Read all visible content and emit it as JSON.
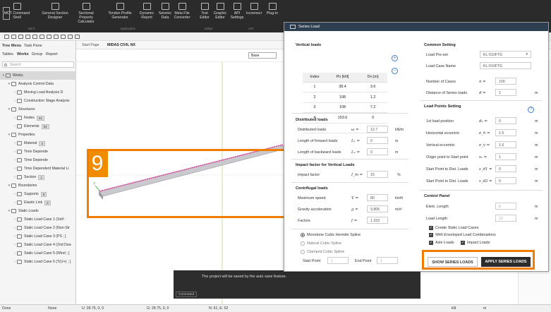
{
  "ribbon": {
    "buttons": [
      {
        "label": "MCT Command",
        "label2": "Shell"
      },
      {
        "label": "General Section",
        "label2": "Designer"
      },
      {
        "label": "Sectional Property",
        "label2": "Calculator"
      },
      {
        "label": "Tendon Profile",
        "label2": "Generator"
      },
      {
        "label": "Dynamic",
        "label2": "Report"
      },
      {
        "label": "Seismic",
        "label2": "Data"
      },
      {
        "label": "Meta File",
        "label2": "Converter"
      },
      {
        "label": "Text",
        "label2": "Editor"
      },
      {
        "label": "Graphic",
        "label2": "Editor"
      },
      {
        "label": "API",
        "label2": "Settings"
      },
      {
        "label": "Icconnect",
        "label2": ""
      },
      {
        "label": "Plug-in",
        "label2": ""
      }
    ],
    "groups": [
      "MCT",
      "Application",
      "Editor",
      "API"
    ]
  },
  "leftpanel": {
    "tabs_top": [
      "Tree Menu",
      "Task Pane"
    ],
    "tabs": [
      "Tables",
      "Works",
      "Group",
      "Report"
    ],
    "search_placeholder": "Search",
    "tree": [
      {
        "label": "Works",
        "level": 0,
        "sel": true,
        "count": ""
      },
      {
        "label": "Analysis Control Data",
        "level": 1,
        "count": ""
      },
      {
        "label": "Moving Load Analysis D",
        "level": 2,
        "count": ""
      },
      {
        "label": "Construction Stage Analysis",
        "level": 2,
        "count": ""
      },
      {
        "label": "Structures",
        "level": 1,
        "count": ""
      },
      {
        "label": "Nodes",
        "level": 2,
        "count": "61"
      },
      {
        "label": "Elements",
        "level": 2,
        "count": "52"
      },
      {
        "label": "Properties",
        "level": 1,
        "count": ""
      },
      {
        "label": "Material",
        "level": 2,
        "count": "2"
      },
      {
        "label": "Time Depende",
        "level": 2,
        "count": ""
      },
      {
        "label": "Time Depende",
        "level": 2,
        "count": ""
      },
      {
        "label": "Time Dependent Material Li",
        "level": 2,
        "count": ""
      },
      {
        "label": "Section",
        "level": 2,
        "count": "1"
      },
      {
        "label": "Boundaries",
        "level": 1,
        "count": ""
      },
      {
        "label": "Supports",
        "level": 2,
        "count": "8"
      },
      {
        "label": "Elastic Link",
        "level": 2,
        "count": "8"
      },
      {
        "label": "Static Loads",
        "level": 1,
        "count": ""
      },
      {
        "label": "Static Load Case 1 (Self :",
        "level": 2,
        "count": ""
      },
      {
        "label": "Static Load Case 2 (Non-Str",
        "level": 2,
        "count": ""
      },
      {
        "label": "Static Load Case 3 (PS ; [",
        "level": 2,
        "count": ""
      },
      {
        "label": "Static Load Case 4 (2nd Dea",
        "level": 2,
        "count": ""
      },
      {
        "label": "Static Load Case 5 (Wind ; [",
        "level": 2,
        "count": ""
      },
      {
        "label": "Static Load Case 6 (T(U+) ; [",
        "level": 2,
        "count": ""
      }
    ]
  },
  "docbar": {
    "start": "Start Page",
    "current": "MIDAS CIVIL NX",
    "view": "Base"
  },
  "badge": "9",
  "message": "The project will be saved by the auto save feature.",
  "command_label": "Command",
  "status": {
    "left": "Done",
    "mode": "None",
    "u": "U: 28.75, 0, 0",
    "g": "G: 28.75, 0, 0",
    "n": "N: 61, E: 52",
    "unit1": "kN",
    "unit2": "m"
  },
  "dialog": {
    "title": "Series Load",
    "vertical": {
      "title": "Vertical loads",
      "headers": [
        "Index",
        "Pn [kN]",
        "Dn [m]"
      ],
      "rows": [
        [
          "1",
          "38.4",
          "3.6"
        ],
        [
          "2",
          "108",
          "1.2"
        ],
        [
          "3",
          "108",
          "7.2"
        ],
        [
          "4",
          "153.6",
          "0"
        ]
      ]
    },
    "distributed": {
      "title": "Distributed loads",
      "fields": [
        {
          "label": "Distributed loads",
          "sym": "ω =",
          "value": "12.7",
          "unit": "kN/m"
        },
        {
          "label": "Length of forward loads",
          "sym": "L₁ =",
          "value": "0",
          "unit": "m"
        },
        {
          "label": "Length of backward loads",
          "sym": "L₂ =",
          "value": "0",
          "unit": "m"
        }
      ]
    },
    "impact": {
      "title": "Impact factor for Vertical Loads",
      "label": "Impact factor",
      "sym": "I_m =",
      "value": "15",
      "unit": "%"
    },
    "centrifugal": {
      "title": "Centrifugal loads",
      "fields": [
        {
          "label": "Maximum speed",
          "sym": "V =",
          "value": "80",
          "unit": "km/h"
        },
        {
          "label": "Gravity acceleration",
          "sym": "g =",
          "value": "9.806",
          "unit": "m/s²"
        },
        {
          "label": "Factors",
          "sym": "f =",
          "value": "1.333",
          "unit": ""
        }
      ]
    },
    "splines": [
      {
        "label": "Monotone Cubic Hermite Spline",
        "on": true
      },
      {
        "label": "Natural Cubic Spline",
        "on": false
      },
      {
        "label": "Clamped Cubic Spline",
        "on": false
      }
    ],
    "start_point_label": "Start Point",
    "start_point_value": "1",
    "end_point_label": "End Point",
    "end_point_value": "1",
    "common": {
      "title": "Common Setting",
      "preset_label": "Load Pre-set",
      "preset_value": "KL-510FTG",
      "casename_label": "Load Case Name",
      "casename_value": "KL-510FTG",
      "cases_label": "Number of Cases",
      "cases_sym": "n =",
      "cases_value": "100",
      "dist_label": "Distance of Series loads",
      "dist_sym": "d =",
      "dist_value": "1",
      "dist_unit": "m"
    },
    "loadpoints": {
      "title": "Load Points Setting",
      "fields": [
        {
          "label": "1st load position",
          "sym": "d₀ =",
          "value": "0",
          "unit": "m"
        },
        {
          "label": "Horizontal eccentric",
          "sym": "e_h =",
          "value": "1.5",
          "unit": "m"
        },
        {
          "label": "Vertical eccentric",
          "sym": "e_v =",
          "value": "1.6",
          "unit": "m"
        },
        {
          "label": "Origin point to Start point",
          "sym": "s₁ =",
          "value": "1",
          "unit": "m"
        },
        {
          "label": "Start Point to Dist. Loads",
          "sym": "s_d1 =",
          "value": "0",
          "unit": "m"
        },
        {
          "label": "Start Point to Dist. Loads",
          "sym": "s_d2 =",
          "value": "0",
          "unit": "m"
        }
      ]
    },
    "control": {
      "title": "Control Panel",
      "elem_label": "Elem. Length",
      "elem_value": "0",
      "elem_unit": "m",
      "load_label": "Load Length",
      "load_value": "12",
      "load_unit": "m",
      "checks": [
        "Create Static Load Cases",
        "With Enveloped Load Combinations",
        "Axle Loads",
        "Impact Loads"
      ]
    },
    "show_btn": "SHOW SERIES LOADS",
    "apply_btn": "APPLY SERIES LOADS"
  },
  "colors": {
    "accent": "#f07c00",
    "dialog_title": "#2c3e50",
    "apply": "#2b2b2b"
  }
}
